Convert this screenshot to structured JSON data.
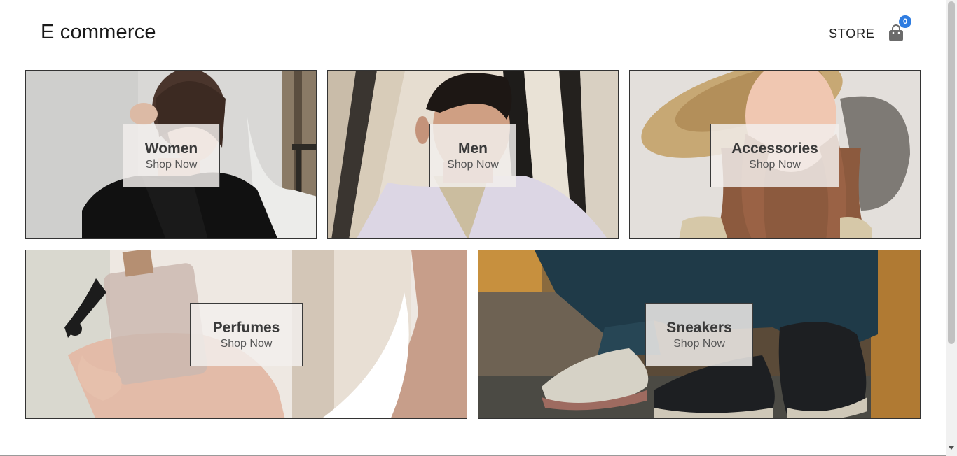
{
  "header": {
    "brand": "E commerce",
    "store_link": "STORE",
    "cart_count": "0",
    "cart_icon": "shopping-bag-icon"
  },
  "categories": [
    {
      "title": "Women",
      "cta": "Shop Now"
    },
    {
      "title": "Men",
      "cta": "Shop Now"
    },
    {
      "title": "Accessories",
      "cta": "Shop Now"
    },
    {
      "title": "Perfumes",
      "cta": "Shop Now"
    },
    {
      "title": "Sneakers",
      "cta": "Shop Now"
    }
  ],
  "colors": {
    "badge": "#2f7de1",
    "label_box_bg": "#f2eeec",
    "border": "#333333"
  }
}
